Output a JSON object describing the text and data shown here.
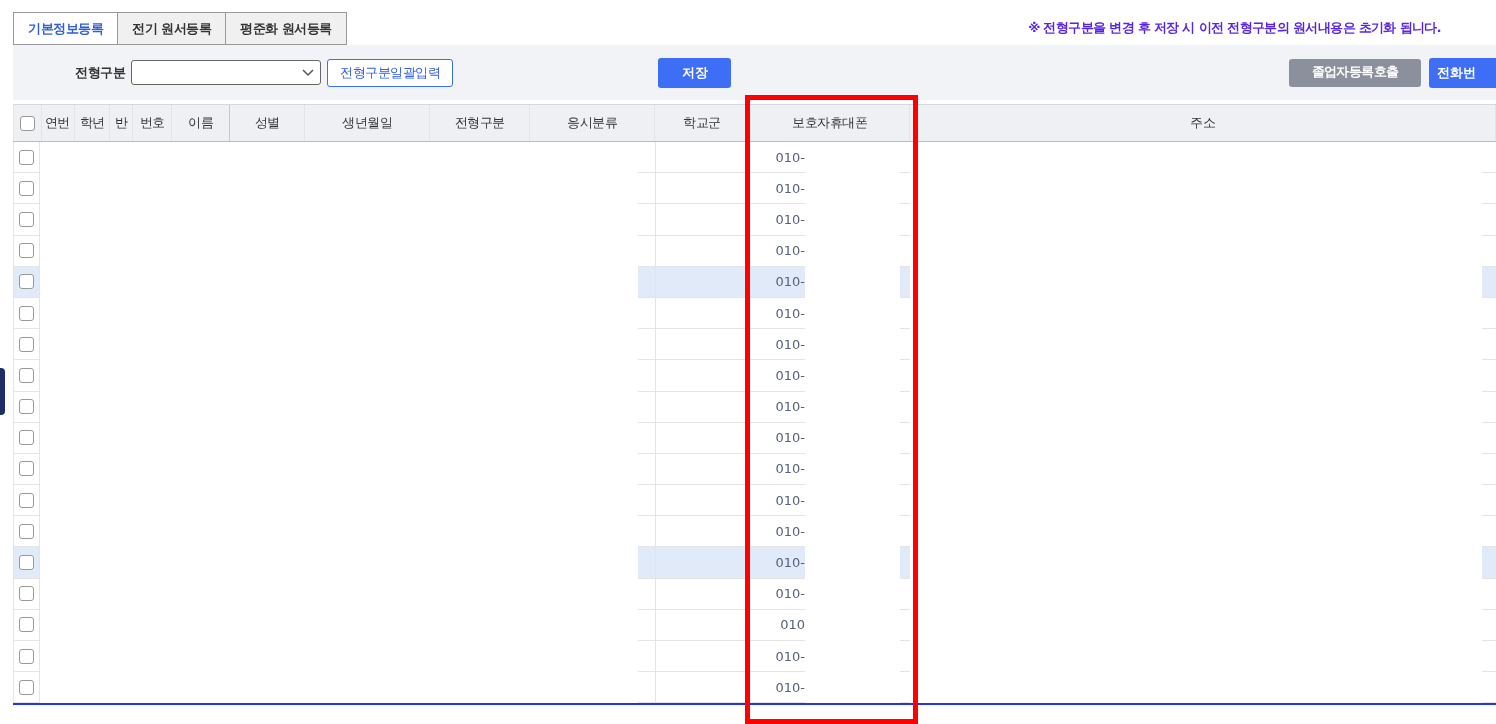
{
  "tabs": [
    {
      "label": "기본정보등록",
      "selected": true
    },
    {
      "label": "전기 원서등록",
      "selected": false
    },
    {
      "label": "평준화 원서등록",
      "selected": false
    }
  ],
  "notice": "※ 전형구분을 변경 후 저장 시 이전 전형구분의 원서내용은 초기화 됩니다.",
  "toolbar": {
    "filter_label": "전형구분",
    "filter_select": {
      "open": false
    },
    "bulk_button": "전형구분일괄입력",
    "save_button": "저장",
    "graduate_button": "졸업자등록호출",
    "phone_button": "전화번"
  },
  "table": {
    "select_all": {
      "checked": false
    },
    "columns": [
      "연번",
      "학년",
      "반",
      "번호",
      "이름",
      "성별",
      "생년월일",
      "전형구분",
      "응시분류",
      "학교군",
      "보호자휴대폰",
      "주소"
    ],
    "rows": [
      {
        "checked": false,
        "selected": false,
        "phone": "010-"
      },
      {
        "checked": false,
        "selected": false,
        "phone": "010-"
      },
      {
        "checked": false,
        "selected": false,
        "phone": "010-"
      },
      {
        "checked": false,
        "selected": false,
        "phone": "010-"
      },
      {
        "checked": false,
        "selected": true,
        "phone": "010-"
      },
      {
        "checked": false,
        "selected": false,
        "phone": "010-"
      },
      {
        "checked": false,
        "selected": false,
        "phone": "010-"
      },
      {
        "checked": false,
        "selected": false,
        "phone": "010-"
      },
      {
        "checked": false,
        "selected": false,
        "phone": "010-"
      },
      {
        "checked": false,
        "selected": false,
        "phone": "010-"
      },
      {
        "checked": false,
        "selected": false,
        "phone": "010-"
      },
      {
        "checked": false,
        "selected": false,
        "phone": "010-"
      },
      {
        "checked": false,
        "selected": false,
        "phone": "010-"
      },
      {
        "checked": false,
        "selected": true,
        "phone": "010-"
      },
      {
        "checked": false,
        "selected": false,
        "phone": "010-"
      },
      {
        "checked": false,
        "selected": false,
        "phone": "010"
      },
      {
        "checked": false,
        "selected": false,
        "phone": "010-"
      },
      {
        "checked": false,
        "selected": false,
        "phone": "010-"
      }
    ]
  }
}
